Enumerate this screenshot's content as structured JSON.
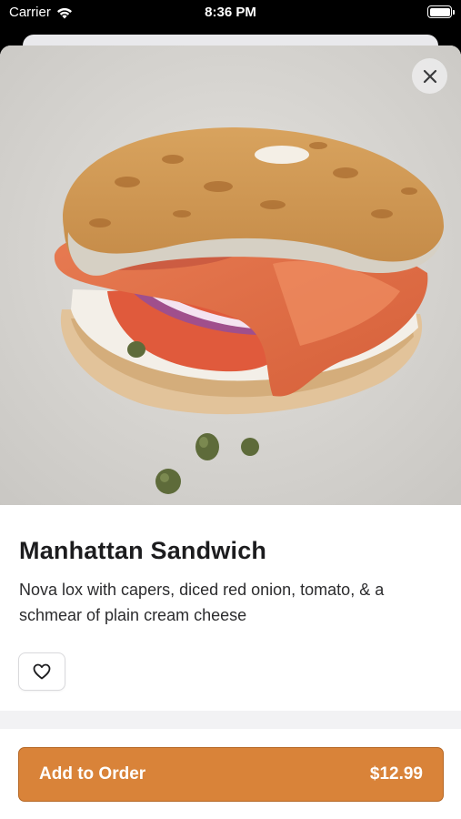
{
  "status_bar": {
    "carrier": "Carrier",
    "time": "8:36 PM"
  },
  "item": {
    "name": "Manhattan Sandwich",
    "description": "Nova lox with capers, diced red onion, tomato, & a schmear of plain cream cheese",
    "photo_icon": "bagel-lox-sandwich-photo"
  },
  "actions": {
    "close_icon": "close-icon",
    "favorite_icon": "heart-icon",
    "add_label": "Add to Order",
    "price": "$12.99"
  },
  "colors": {
    "accent": "#d98339",
    "background": "#f2f2f4"
  }
}
